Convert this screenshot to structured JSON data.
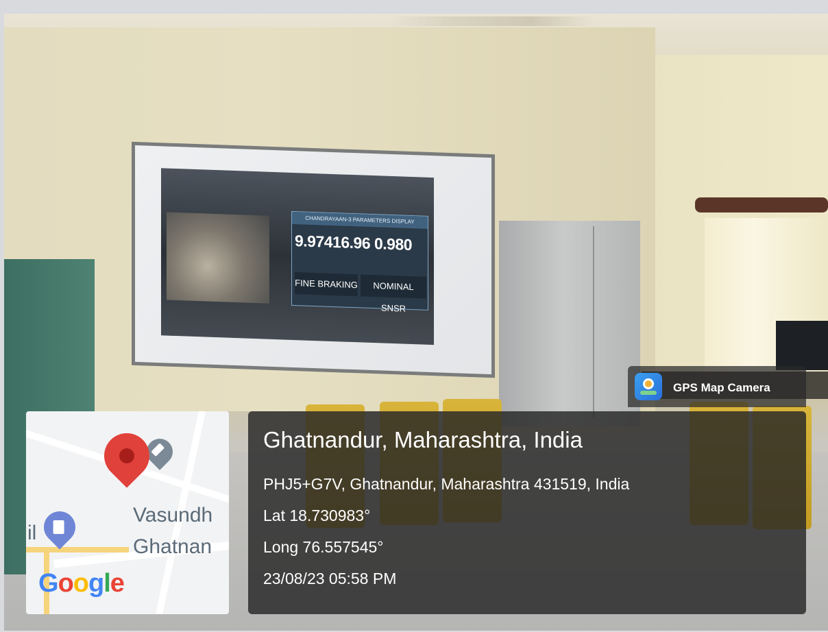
{
  "projected_screen": {
    "header": "CHANDRAYAAN-3 PARAMETERS DISPLAY",
    "numbers": "9.97416.96 0.980",
    "box_left": "FINE BRAKING",
    "box_right": "NOMINAL SNSR"
  },
  "gps_overlay": {
    "app_label": "GPS Map Camera",
    "location_title": "Ghatnandur, Maharashtra, India",
    "address": "PHJ5+G7V, Ghatnandur, Maharashtra 431519, India",
    "lat": "Lat 18.730983°",
    "long": "Long 76.557545°",
    "datetime": "23/08/23 05:58 PM"
  },
  "map": {
    "place_line1": "Vasundh",
    "place_line2": "Ghatnan",
    "edge_text": "il",
    "logo": [
      "G",
      "o",
      "o",
      "g",
      "l",
      "e"
    ]
  },
  "colors": {
    "overlay_bg": "#262626",
    "pin_red": "#e0413a",
    "google_blue": "#4285f4",
    "google_red": "#ea4335",
    "google_yellow": "#fbbc05",
    "google_green": "#34a853"
  }
}
